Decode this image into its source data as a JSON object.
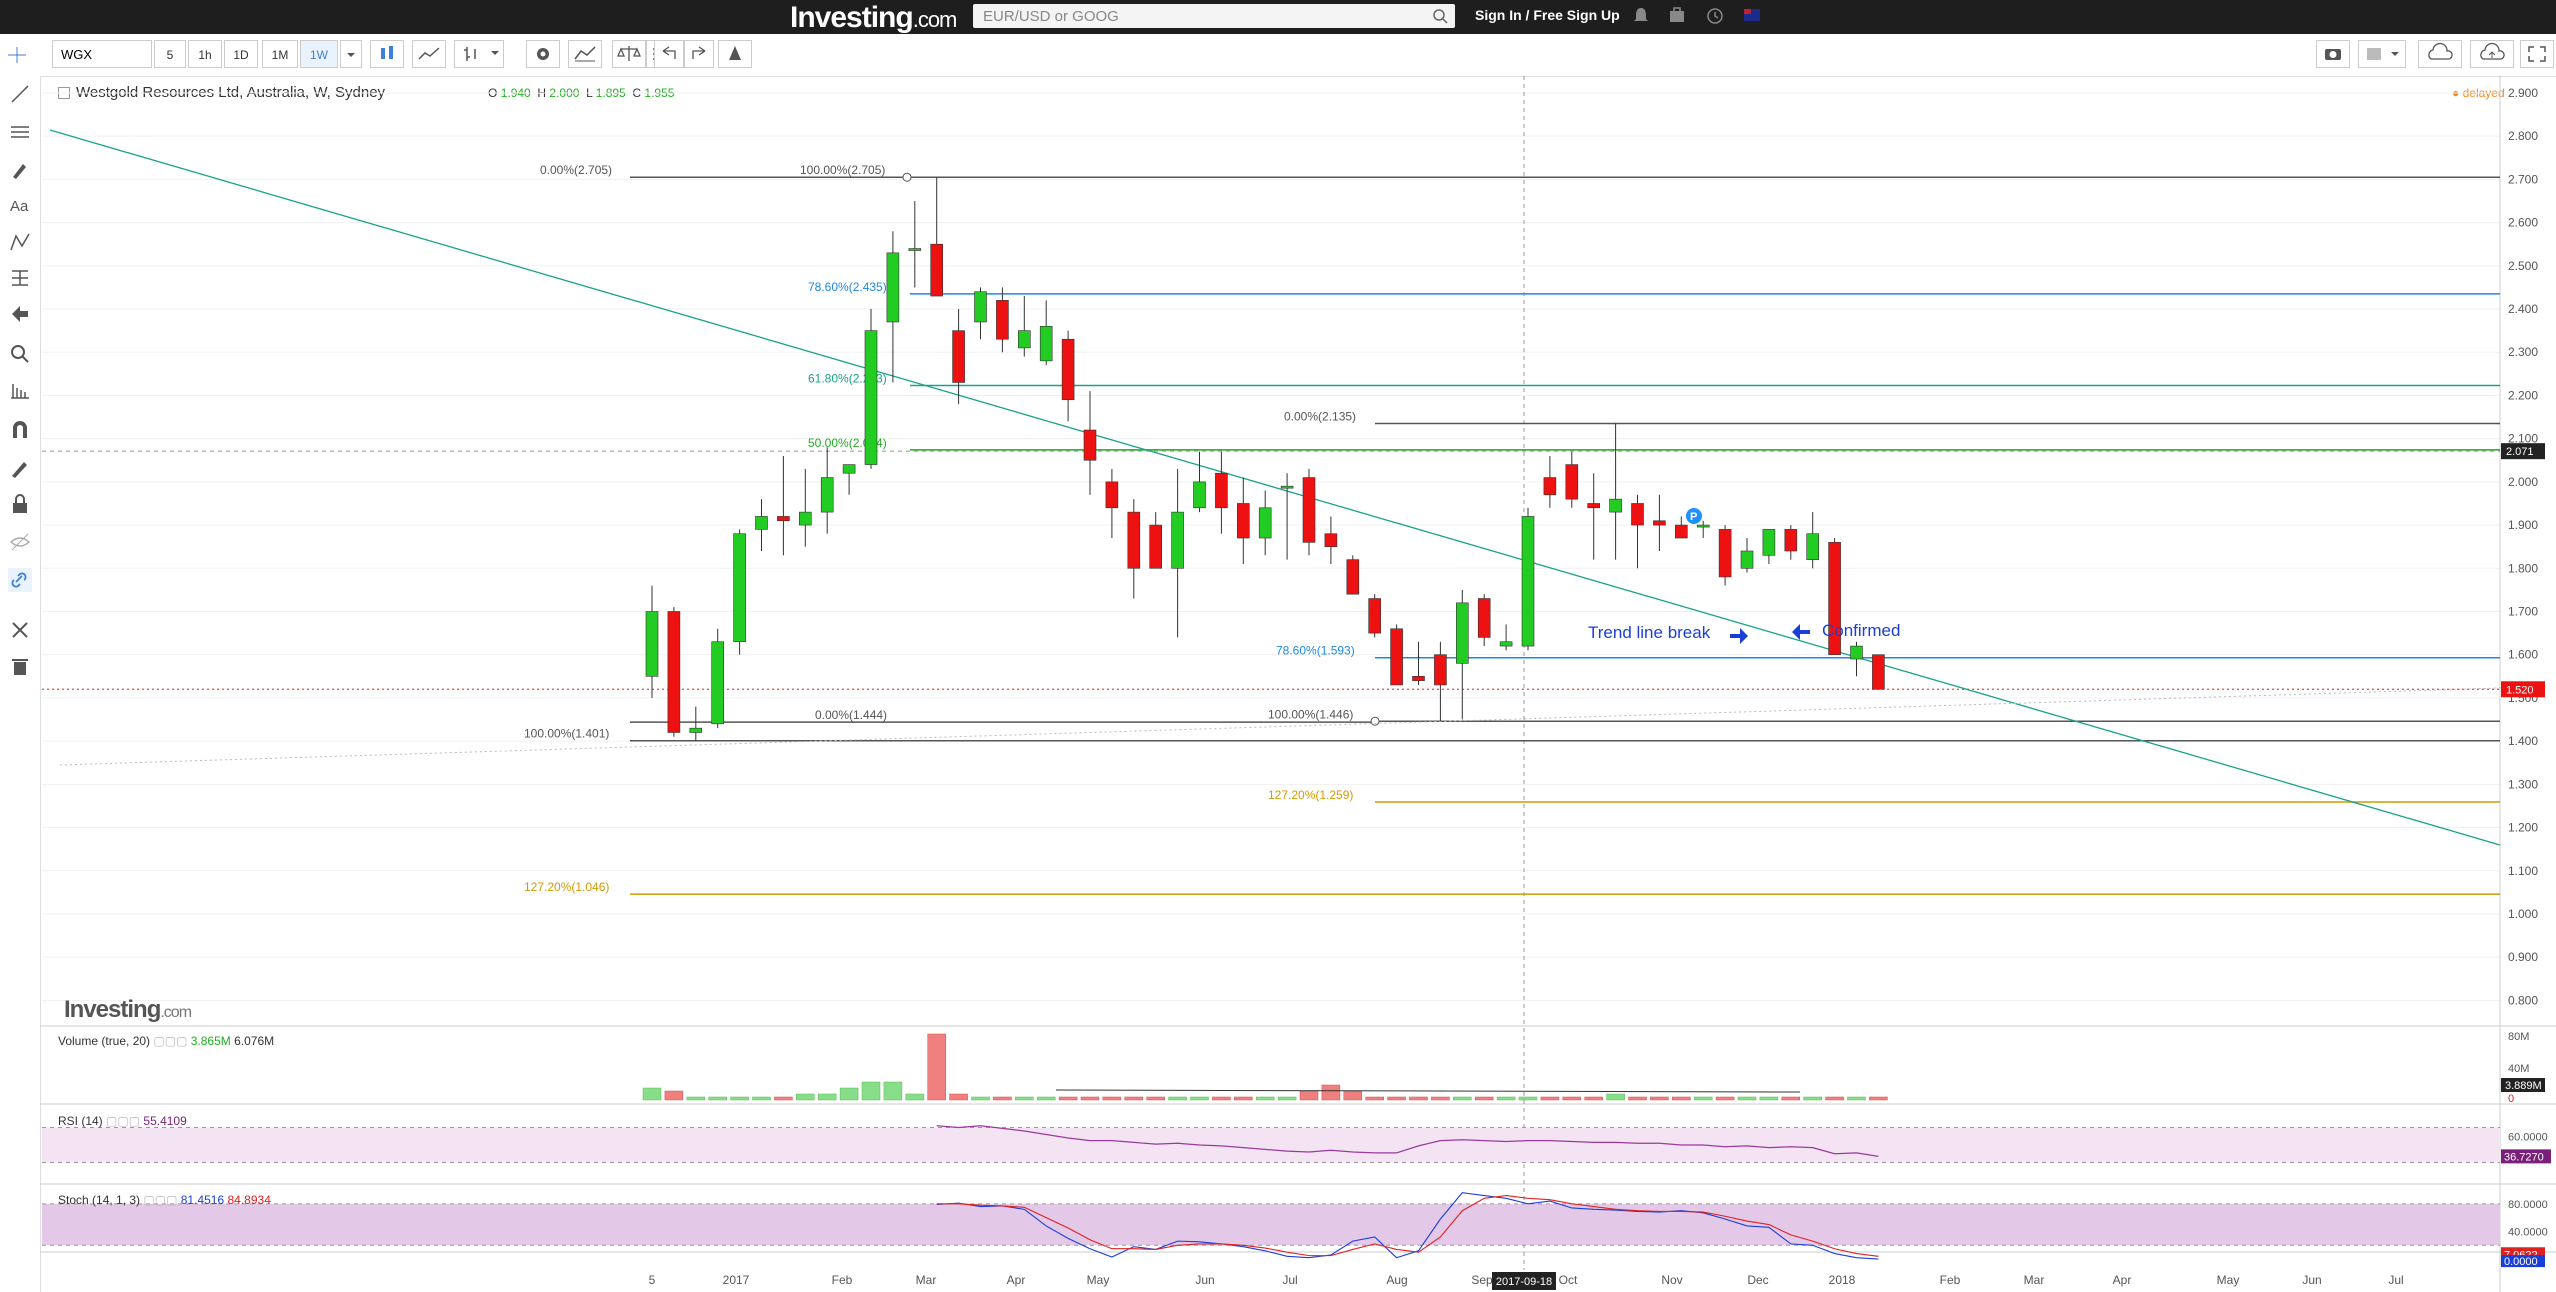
{
  "header": {
    "logo": "Investing",
    "logo_suffix": ".com",
    "search_placeholder": "EUR/USD or GOOG",
    "signin": "Sign In / Free Sign Up"
  },
  "toolbar": {
    "symbol": "WGX",
    "intervals": [
      "5",
      "1h",
      "1D",
      "1M",
      "1W"
    ],
    "active_interval": "1W"
  },
  "legend": {
    "title": "Westgold Resources Ltd, Australia, W, Sydney",
    "o_label": "O",
    "o": "1.940",
    "h_label": "H",
    "h": "2.000",
    "l_label": "L",
    "l": "1.895",
    "c_label": "C",
    "c": "1.955",
    "delayed": "delayed"
  },
  "watermark": {
    "main": "Investing",
    "suffix": ".com"
  },
  "colors": {
    "up": "#22cc22",
    "down": "#ee1111",
    "trend": "#1aa38a",
    "fib786": "#1e88e5",
    "fib618": "#1aa38a",
    "fib50": "#22aa22",
    "fib1272": "#d49a00",
    "fib100": "#555555",
    "annotation": "#1a3fd9"
  },
  "chart_data": {
    "type": "candlestick",
    "interval": "weekly",
    "title": "Westgold Resources Ltd, Australia, W, Sydney",
    "ylim": [
      0.75,
      2.93
    ],
    "y_ticks": [
      "2.900",
      "2.800",
      "2.700",
      "2.600",
      "2.500",
      "2.400",
      "2.300",
      "2.200",
      "2.100",
      "2.000",
      "1.900",
      "1.800",
      "1.700",
      "1.600",
      "1.500",
      "1.400",
      "1.300",
      "1.200",
      "1.100",
      "1.000",
      "0.900",
      "0.800"
    ],
    "x_ticks": [
      "5",
      "2017",
      "Feb",
      "Mar",
      "Apr",
      "May",
      "Jun",
      "Jul",
      "Aug",
      "Sep",
      "Oct",
      "Nov",
      "Dec",
      "2018",
      "Feb",
      "Mar",
      "Apr",
      "May",
      "Jun",
      "Jul"
    ],
    "x_cursor_label": "2017-09-18",
    "price_labels": {
      "cursor": "2.071",
      "last": "1.520"
    },
    "candles": [
      {
        "o": 1.55,
        "h": 1.76,
        "l": 1.5,
        "c": 1.7
      },
      {
        "o": 1.7,
        "h": 1.71,
        "l": 1.41,
        "c": 1.42
      },
      {
        "o": 1.42,
        "h": 1.48,
        "l": 1.4,
        "c": 1.43
      },
      {
        "o": 1.44,
        "h": 1.66,
        "l": 1.43,
        "c": 1.63
      },
      {
        "o": 1.63,
        "h": 1.89,
        "l": 1.6,
        "c": 1.88
      },
      {
        "o": 1.89,
        "h": 1.96,
        "l": 1.84,
        "c": 1.92
      },
      {
        "o": 1.92,
        "h": 2.06,
        "l": 1.83,
        "c": 1.91
      },
      {
        "o": 1.9,
        "h": 2.03,
        "l": 1.85,
        "c": 1.93
      },
      {
        "o": 1.93,
        "h": 2.08,
        "l": 1.88,
        "c": 2.01
      },
      {
        "o": 2.02,
        "h": 2.04,
        "l": 1.97,
        "c": 2.04
      },
      {
        "o": 2.04,
        "h": 2.4,
        "l": 2.03,
        "c": 2.35
      },
      {
        "o": 2.37,
        "h": 2.58,
        "l": 2.23,
        "c": 2.53
      },
      {
        "o": 2.54,
        "h": 2.65,
        "l": 2.45,
        "c": 2.54
      },
      {
        "o": 2.55,
        "h": 2.705,
        "l": 2.43,
        "c": 2.43
      },
      {
        "o": 2.35,
        "h": 2.4,
        "l": 2.18,
        "c": 2.23
      },
      {
        "o": 2.37,
        "h": 2.45,
        "l": 2.33,
        "c": 2.44
      },
      {
        "o": 2.42,
        "h": 2.45,
        "l": 2.3,
        "c": 2.33
      },
      {
        "o": 2.31,
        "h": 2.43,
        "l": 2.29,
        "c": 2.35
      },
      {
        "o": 2.28,
        "h": 2.42,
        "l": 2.27,
        "c": 2.36
      },
      {
        "o": 2.33,
        "h": 2.35,
        "l": 2.14,
        "c": 2.19
      },
      {
        "o": 2.12,
        "h": 2.21,
        "l": 1.97,
        "c": 2.05
      },
      {
        "o": 2.0,
        "h": 2.03,
        "l": 1.87,
        "c": 1.94
      },
      {
        "o": 1.93,
        "h": 1.96,
        "l": 1.73,
        "c": 1.8
      },
      {
        "o": 1.9,
        "h": 1.93,
        "l": 1.8,
        "c": 1.8
      },
      {
        "o": 1.8,
        "h": 2.03,
        "l": 1.64,
        "c": 1.93
      },
      {
        "o": 1.94,
        "h": 2.07,
        "l": 1.93,
        "c": 2.0
      },
      {
        "o": 2.02,
        "h": 2.07,
        "l": 1.88,
        "c": 1.94
      },
      {
        "o": 1.95,
        "h": 2.01,
        "l": 1.81,
        "c": 1.87
      },
      {
        "o": 1.87,
        "h": 1.98,
        "l": 1.83,
        "c": 1.94
      },
      {
        "o": 1.99,
        "h": 2.02,
        "l": 1.82,
        "c": 1.99
      },
      {
        "o": 2.01,
        "h": 2.03,
        "l": 1.83,
        "c": 1.86
      },
      {
        "o": 1.88,
        "h": 1.92,
        "l": 1.81,
        "c": 1.85
      },
      {
        "o": 1.82,
        "h": 1.83,
        "l": 1.74,
        "c": 1.74
      },
      {
        "o": 1.73,
        "h": 1.74,
        "l": 1.64,
        "c": 1.65
      },
      {
        "o": 1.66,
        "h": 1.67,
        "l": 1.53,
        "c": 1.53
      },
      {
        "o": 1.55,
        "h": 1.63,
        "l": 1.53,
        "c": 1.54
      },
      {
        "o": 1.6,
        "h": 1.63,
        "l": 1.446,
        "c": 1.53
      },
      {
        "o": 1.58,
        "h": 1.75,
        "l": 1.45,
        "c": 1.72
      },
      {
        "o": 1.73,
        "h": 1.74,
        "l": 1.62,
        "c": 1.64
      },
      {
        "o": 1.62,
        "h": 1.67,
        "l": 1.61,
        "c": 1.63
      },
      {
        "o": 1.62,
        "h": 1.94,
        "l": 1.61,
        "c": 1.92
      },
      {
        "o": 2.01,
        "h": 2.06,
        "l": 1.94,
        "c": 1.97
      },
      {
        "o": 2.04,
        "h": 2.07,
        "l": 1.94,
        "c": 1.96
      },
      {
        "o": 1.95,
        "h": 2.02,
        "l": 1.82,
        "c": 1.94
      },
      {
        "o": 1.93,
        "h": 2.135,
        "l": 1.82,
        "c": 1.96
      },
      {
        "o": 1.95,
        "h": 1.97,
        "l": 1.8,
        "c": 1.9
      },
      {
        "o": 1.91,
        "h": 1.97,
        "l": 1.84,
        "c": 1.9
      },
      {
        "o": 1.9,
        "h": 1.92,
        "l": 1.87,
        "c": 1.87
      },
      {
        "o": 1.9,
        "h": 1.91,
        "l": 1.87,
        "c": 1.9
      },
      {
        "o": 1.89,
        "h": 1.9,
        "l": 1.76,
        "c": 1.78
      },
      {
        "o": 1.8,
        "h": 1.87,
        "l": 1.79,
        "c": 1.84
      },
      {
        "o": 1.83,
        "h": 1.88,
        "l": 1.81,
        "c": 1.89
      },
      {
        "o": 1.89,
        "h": 1.9,
        "l": 1.82,
        "c": 1.84
      },
      {
        "o": 1.82,
        "h": 1.93,
        "l": 1.8,
        "c": 1.88
      },
      {
        "o": 1.86,
        "h": 1.87,
        "l": 1.6,
        "c": 1.6
      },
      {
        "o": 1.59,
        "h": 1.63,
        "l": 1.55,
        "c": 1.62
      },
      {
        "o": 1.6,
        "h": 1.6,
        "l": 1.52,
        "c": 1.52
      }
    ],
    "fib_levels": [
      {
        "label": "0.00%(2.705)",
        "value": 2.705
      },
      {
        "label": "100.00%(2.705)",
        "value": 2.705
      },
      {
        "label": "78.60%(2.435)",
        "value": 2.435
      },
      {
        "label": "61.80%(2.223)",
        "value": 2.223
      },
      {
        "label": "50.00%(2.074)",
        "value": 2.074
      },
      {
        "label": "0.00%(2.135)",
        "value": 2.135
      },
      {
        "label": "78.60%(1.593)",
        "value": 1.593
      },
      {
        "label": "0.00%(1.444)",
        "value": 1.444
      },
      {
        "label": "100.00%(1.446)",
        "value": 1.446
      },
      {
        "label": "100.00%(1.401)",
        "value": 1.401
      },
      {
        "label": "127.20%(1.259)",
        "value": 1.259
      },
      {
        "label": "127.20%(1.046)",
        "value": 1.046
      }
    ],
    "annotations": [
      "Trend line break",
      "Confirmed"
    ],
    "marker": "P",
    "volume": {
      "title": "Volume (true, 20)",
      "v1": "3.865M",
      "v2": "6.076M",
      "y_ticks": [
        "80M",
        "40M"
      ],
      "last_label": "3.889M",
      "zero_label": "0",
      "values": [
        4,
        3,
        1,
        1,
        1,
        1,
        1,
        2,
        2,
        4,
        6,
        6,
        2,
        22,
        2,
        1,
        1,
        1,
        1,
        1,
        1,
        1,
        1,
        1,
        1,
        1,
        1,
        1,
        1,
        1,
        3,
        5,
        3,
        1,
        1,
        1,
        1,
        1,
        1,
        1,
        1,
        1,
        1,
        1,
        2,
        1,
        1,
        1,
        1,
        1,
        1,
        1,
        1,
        1,
        1,
        1,
        1
      ]
    },
    "rsi": {
      "title": "RSI (14)",
      "value": "55.4109",
      "y_ticks": [
        "60.0000",
        "40.0000"
      ],
      "last_label": "36.7270",
      "values": [
        null,
        null,
        null,
        null,
        null,
        null,
        null,
        null,
        null,
        null,
        null,
        null,
        null,
        72,
        70,
        72,
        69,
        66,
        62,
        58,
        55,
        55,
        53,
        51,
        52,
        50,
        49,
        47,
        45,
        43,
        42,
        44,
        42,
        41,
        41,
        49,
        55,
        56,
        55,
        54,
        55,
        55,
        54,
        53,
        53,
        52,
        52,
        50,
        50,
        48,
        49,
        47,
        48,
        47,
        40,
        41,
        37
      ]
    },
    "stoch": {
      "title": "Stoch (14, 1, 3)",
      "k": "81.4516",
      "d": "84.8934",
      "y_ticks": [
        "80.0000",
        "40.0000"
      ],
      "k_label": "7.0622",
      "d_label": "0.0000",
      "k_values": [
        null,
        null,
        null,
        null,
        null,
        null,
        null,
        null,
        null,
        null,
        null,
        null,
        null,
        79,
        81,
        76,
        77,
        72,
        48,
        30,
        15,
        3,
        18,
        14,
        26,
        25,
        22,
        18,
        12,
        4,
        2,
        6,
        26,
        32,
        2,
        12,
        58,
        96,
        92,
        88,
        80,
        84,
        74,
        72,
        71,
        69,
        68,
        70,
        67,
        58,
        48,
        46,
        22,
        20,
        8,
        2,
        0
      ],
      "d_values": [
        null,
        null,
        null,
        null,
        null,
        null,
        null,
        null,
        null,
        null,
        null,
        null,
        null,
        80,
        80,
        78,
        77,
        75,
        60,
        45,
        28,
        15,
        15,
        14,
        20,
        22,
        22,
        20,
        16,
        10,
        5,
        5,
        14,
        22,
        14,
        10,
        32,
        70,
        88,
        92,
        88,
        86,
        80,
        76,
        72,
        70,
        69,
        69,
        68,
        62,
        55,
        50,
        35,
        26,
        15,
        8,
        4
      ]
    }
  }
}
